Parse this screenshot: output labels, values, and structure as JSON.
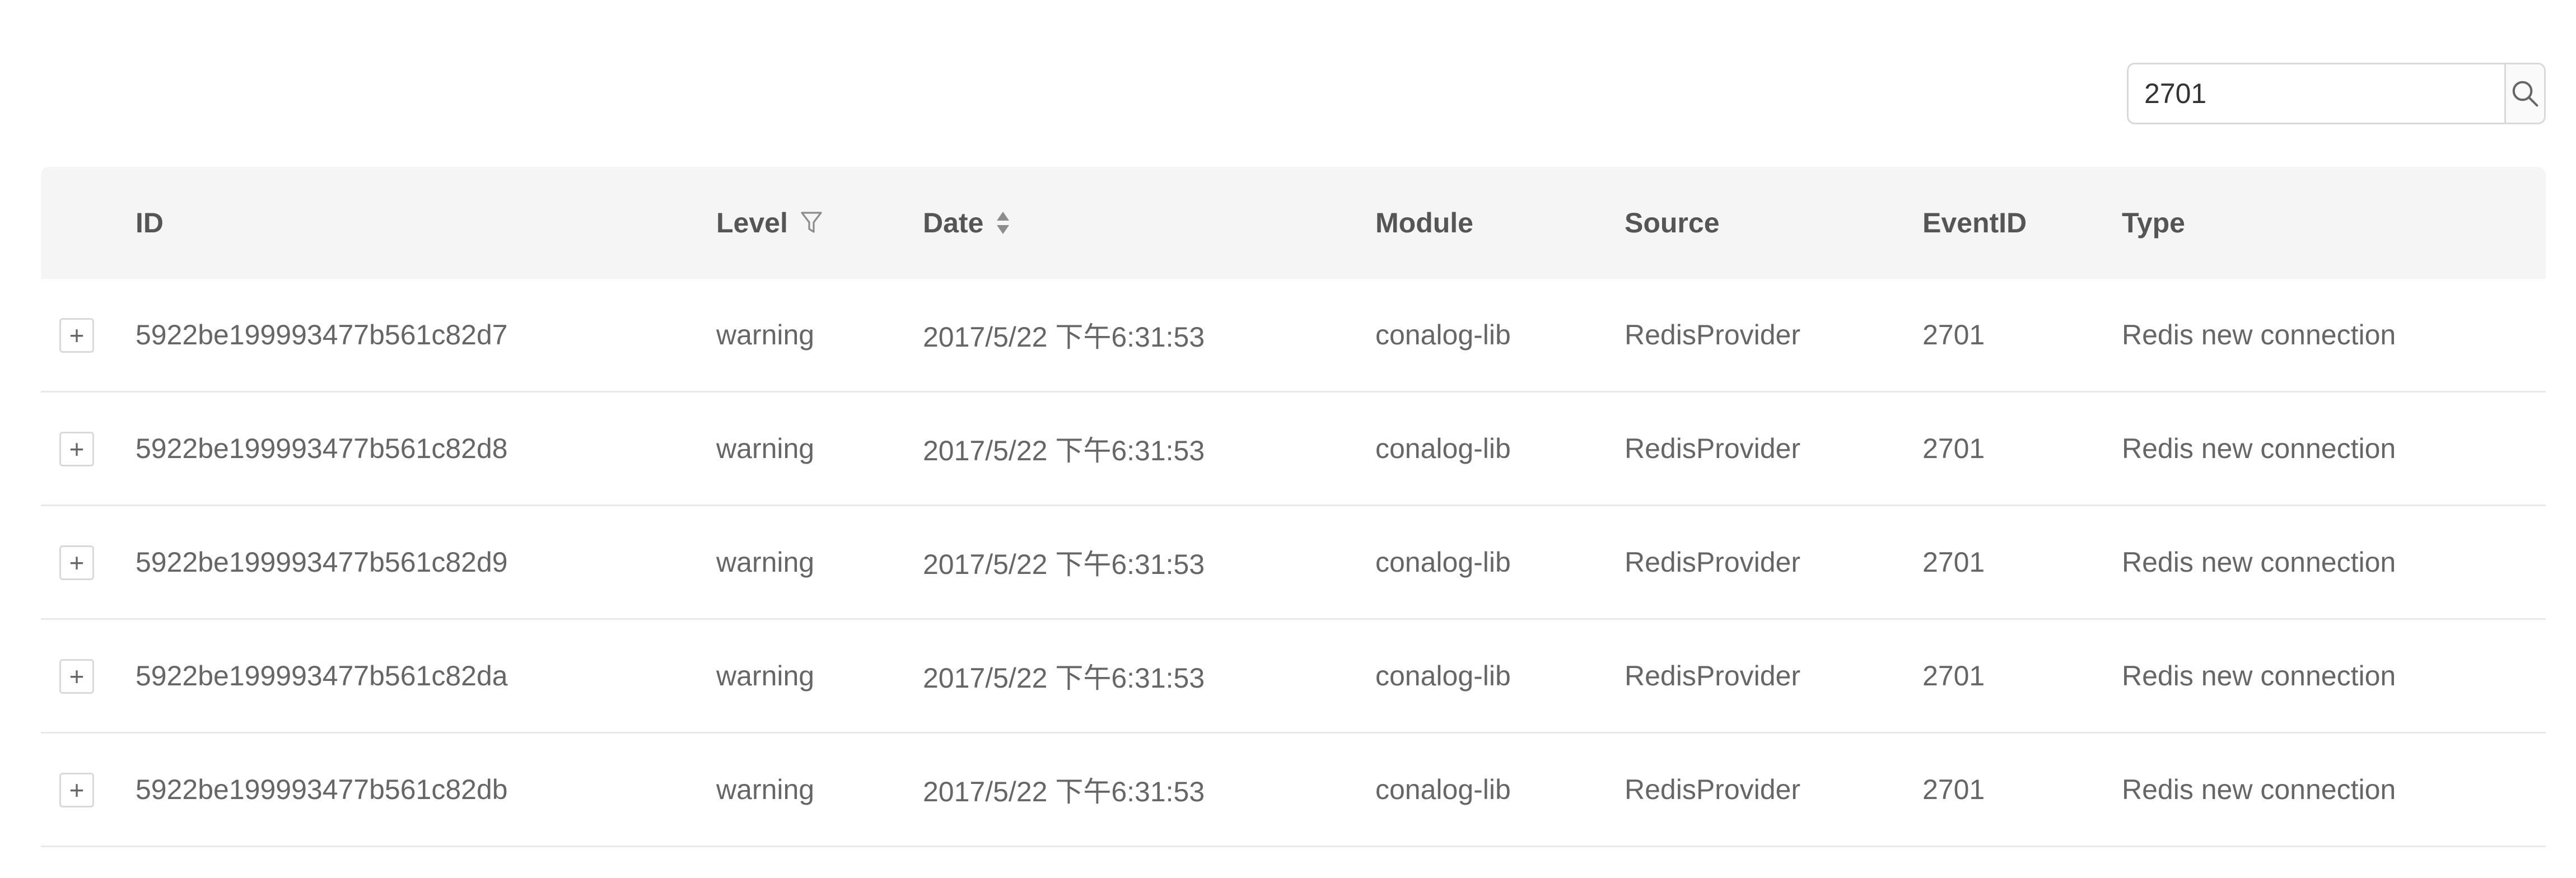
{
  "search": {
    "value": "2701",
    "icon": "search-icon"
  },
  "table": {
    "columns": [
      {
        "key": "id",
        "label": "ID"
      },
      {
        "key": "level",
        "label": "Level",
        "icon": "filter-icon"
      },
      {
        "key": "date",
        "label": "Date",
        "icon": "sort-icon"
      },
      {
        "key": "module",
        "label": "Module"
      },
      {
        "key": "source",
        "label": "Source"
      },
      {
        "key": "eventid",
        "label": "EventID"
      },
      {
        "key": "type",
        "label": "Type"
      }
    ],
    "rows": [
      {
        "expand": "+",
        "id": "5922be199993477b561c82d7",
        "level": "warning",
        "date": "2017/5/22 下午6:31:53",
        "module": "conalog-lib",
        "source": "RedisProvider",
        "eventid": "2701",
        "type": "Redis new connection"
      },
      {
        "expand": "+",
        "id": "5922be199993477b561c82d8",
        "level": "warning",
        "date": "2017/5/22 下午6:31:53",
        "module": "conalog-lib",
        "source": "RedisProvider",
        "eventid": "2701",
        "type": "Redis new connection"
      },
      {
        "expand": "+",
        "id": "5922be199993477b561c82d9",
        "level": "warning",
        "date": "2017/5/22 下午6:31:53",
        "module": "conalog-lib",
        "source": "RedisProvider",
        "eventid": "2701",
        "type": "Redis new connection"
      },
      {
        "expand": "+",
        "id": "5922be199993477b561c82da",
        "level": "warning",
        "date": "2017/5/22 下午6:31:53",
        "module": "conalog-lib",
        "source": "RedisProvider",
        "eventid": "2701",
        "type": "Redis new connection"
      },
      {
        "expand": "+",
        "id": "5922be199993477b561c82db",
        "level": "warning",
        "date": "2017/5/22 下午6:31:53",
        "module": "conalog-lib",
        "source": "RedisProvider",
        "eventid": "2701",
        "type": "Redis new connection"
      }
    ]
  }
}
